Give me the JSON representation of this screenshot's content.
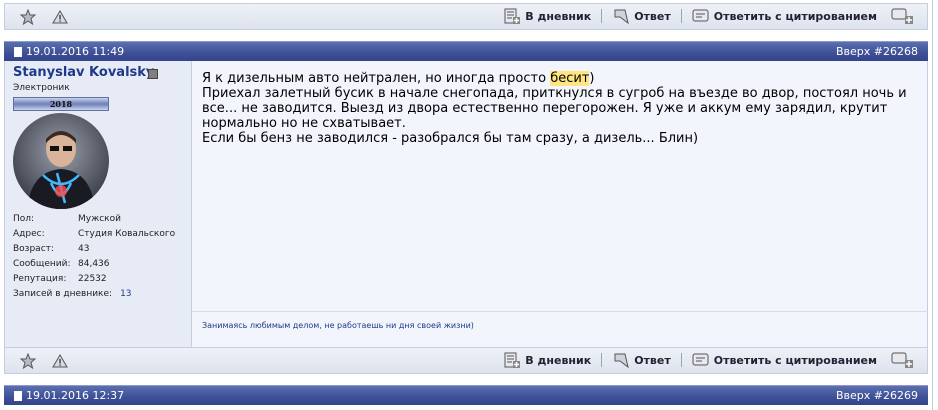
{
  "actions": {
    "diary": "В дневник",
    "reply": "Ответ",
    "quote": "Ответить с цитированием"
  },
  "post1": {
    "date": "19.01.2016 11:49",
    "top_link": "Вверх #26268",
    "user": {
      "name": "Stanyslav Kovalsky",
      "title": "Электроник",
      "rank_label": "2018",
      "fields": [
        {
          "label": "Пол:",
          "value": "Мужской"
        },
        {
          "label": "Адрес:",
          "value": "Студия Ковальского"
        },
        {
          "label": "Возраст:",
          "value": "43"
        },
        {
          "label": "Сообщений:",
          "value": "84,436"
        },
        {
          "label": "Репутация:",
          "value": "22532"
        }
      ],
      "diary_label": "Записей в дневнике:",
      "diary_count": "13"
    },
    "message": {
      "line1_pre": "Я к дизельным авто нейтрален, но иногда просто ",
      "line1_hl": "бесит",
      "line1_post": ")",
      "rest": "Приехал залетный бусик в начале снегопада, приткнулся в сугроб на въезде во двор, постоял ночь и все... не заводится. Выезд из двора естественно перегорожен. Я уже и аккум ему зарядил, крутит нормально но не схватывает.",
      "last": "Если бы бенз не заводился - разобрался бы там сразу, а дизель... Блин)"
    },
    "signature": "Занимаясь любимым делом, не работаешь ни дня своей жизни)"
  },
  "post2": {
    "date": "19.01.2016 12:37",
    "top_link": "Вверх #26269"
  }
}
